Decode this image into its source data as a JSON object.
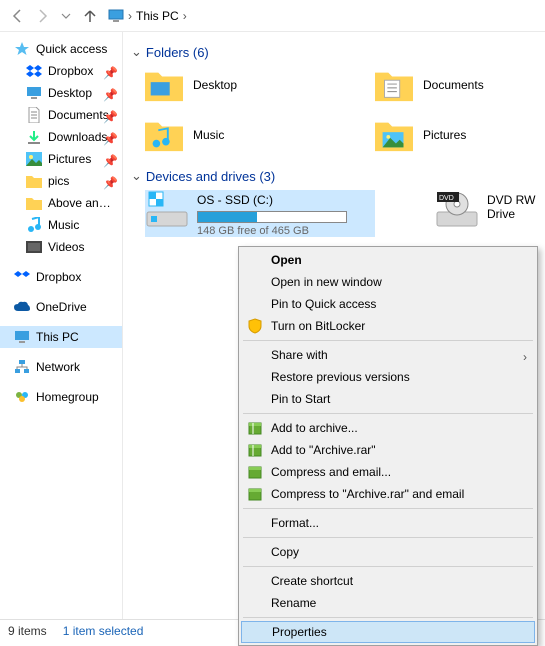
{
  "breadcrumb": {
    "title": "This PC"
  },
  "sidebar": {
    "quick_access": "Quick access",
    "items": [
      {
        "label": "Dropbox",
        "pinned": true
      },
      {
        "label": "Desktop",
        "pinned": true
      },
      {
        "label": "Documents",
        "pinned": true
      },
      {
        "label": "Downloads",
        "pinned": true
      },
      {
        "label": "Pictures",
        "pinned": true
      },
      {
        "label": "pics",
        "pinned": true
      },
      {
        "label": "Above and Beyond",
        "pinned": false
      },
      {
        "label": "Music",
        "pinned": false
      },
      {
        "label": "Videos",
        "pinned": false
      }
    ],
    "dropbox": "Dropbox",
    "onedrive": "OneDrive",
    "this_pc": "This PC",
    "network": "Network",
    "homegroup": "Homegroup"
  },
  "main": {
    "folders_header": "Folders (6)",
    "devices_header": "Devices and drives (3)",
    "folders": [
      {
        "label": "Desktop"
      },
      {
        "label": "Documents"
      },
      {
        "label": "Music"
      },
      {
        "label": "Pictures"
      }
    ],
    "drive": {
      "name": "OS - SSD (C:)",
      "subtext": "148 GB free of 465 GB",
      "fill_pct": 40
    },
    "dvd": {
      "label": "DVD RW Drive"
    }
  },
  "context_menu": {
    "open": "Open",
    "open_new": "Open in new window",
    "pin_quick": "Pin to Quick access",
    "bitlocker": "Turn on BitLocker",
    "share_with": "Share with",
    "restore": "Restore previous versions",
    "pin_start": "Pin to Start",
    "add_archive": "Add to archive...",
    "add_archive_rar": "Add to \"Archive.rar\"",
    "compress_email": "Compress and email...",
    "compress_rar_email": "Compress to \"Archive.rar\" and email",
    "format": "Format...",
    "copy": "Copy",
    "create_shortcut": "Create shortcut",
    "rename": "Rename",
    "properties": "Properties"
  },
  "statusbar": {
    "items": "9 items",
    "selected": "1 item selected"
  }
}
